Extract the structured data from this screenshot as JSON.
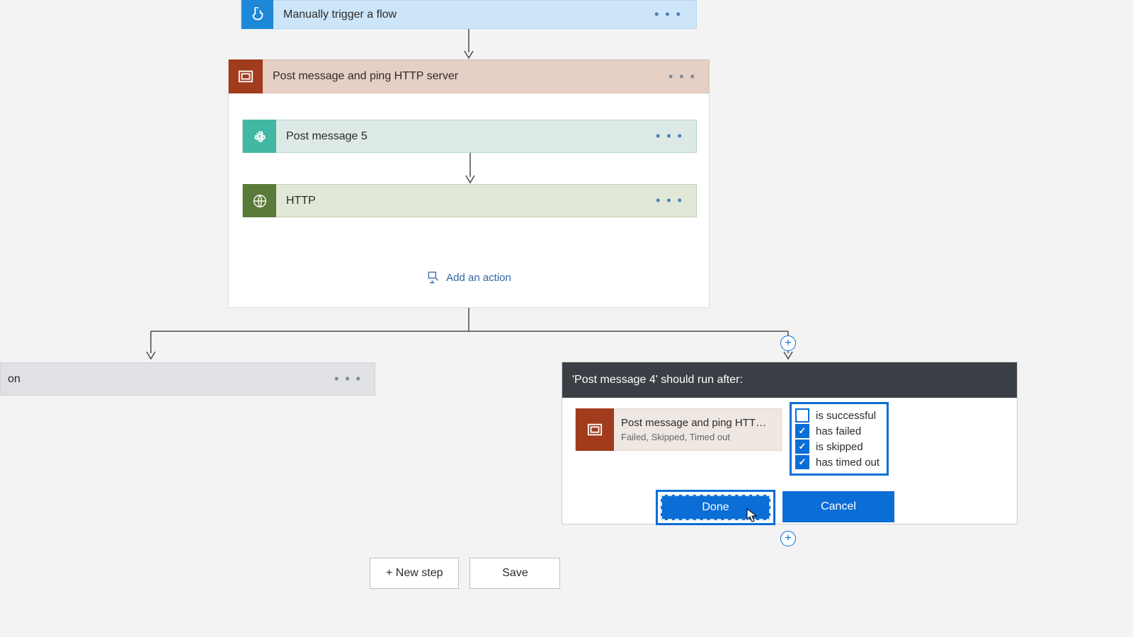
{
  "trigger": {
    "title": "Manually trigger a flow"
  },
  "scope": {
    "title": "Post message and ping HTTP server"
  },
  "inner1": {
    "title": "Post message 5"
  },
  "inner2": {
    "title": "HTTP"
  },
  "addAction": "Add an action",
  "leftBranch": {
    "text": "on"
  },
  "runAfter": {
    "header": "'Post message 4' should run after:",
    "predecessor": {
      "title": "Post message and ping HTTP s...",
      "sub": "Failed, Skipped, Timed out"
    },
    "conditions": {
      "successful": {
        "label": "is successful",
        "checked": false
      },
      "failed": {
        "label": "has failed",
        "checked": true
      },
      "skipped": {
        "label": "is skipped",
        "checked": true
      },
      "timedout": {
        "label": "has timed out",
        "checked": true
      }
    },
    "done": "Done",
    "cancel": "Cancel"
  },
  "newStep": "+ New step",
  "save": "Save"
}
